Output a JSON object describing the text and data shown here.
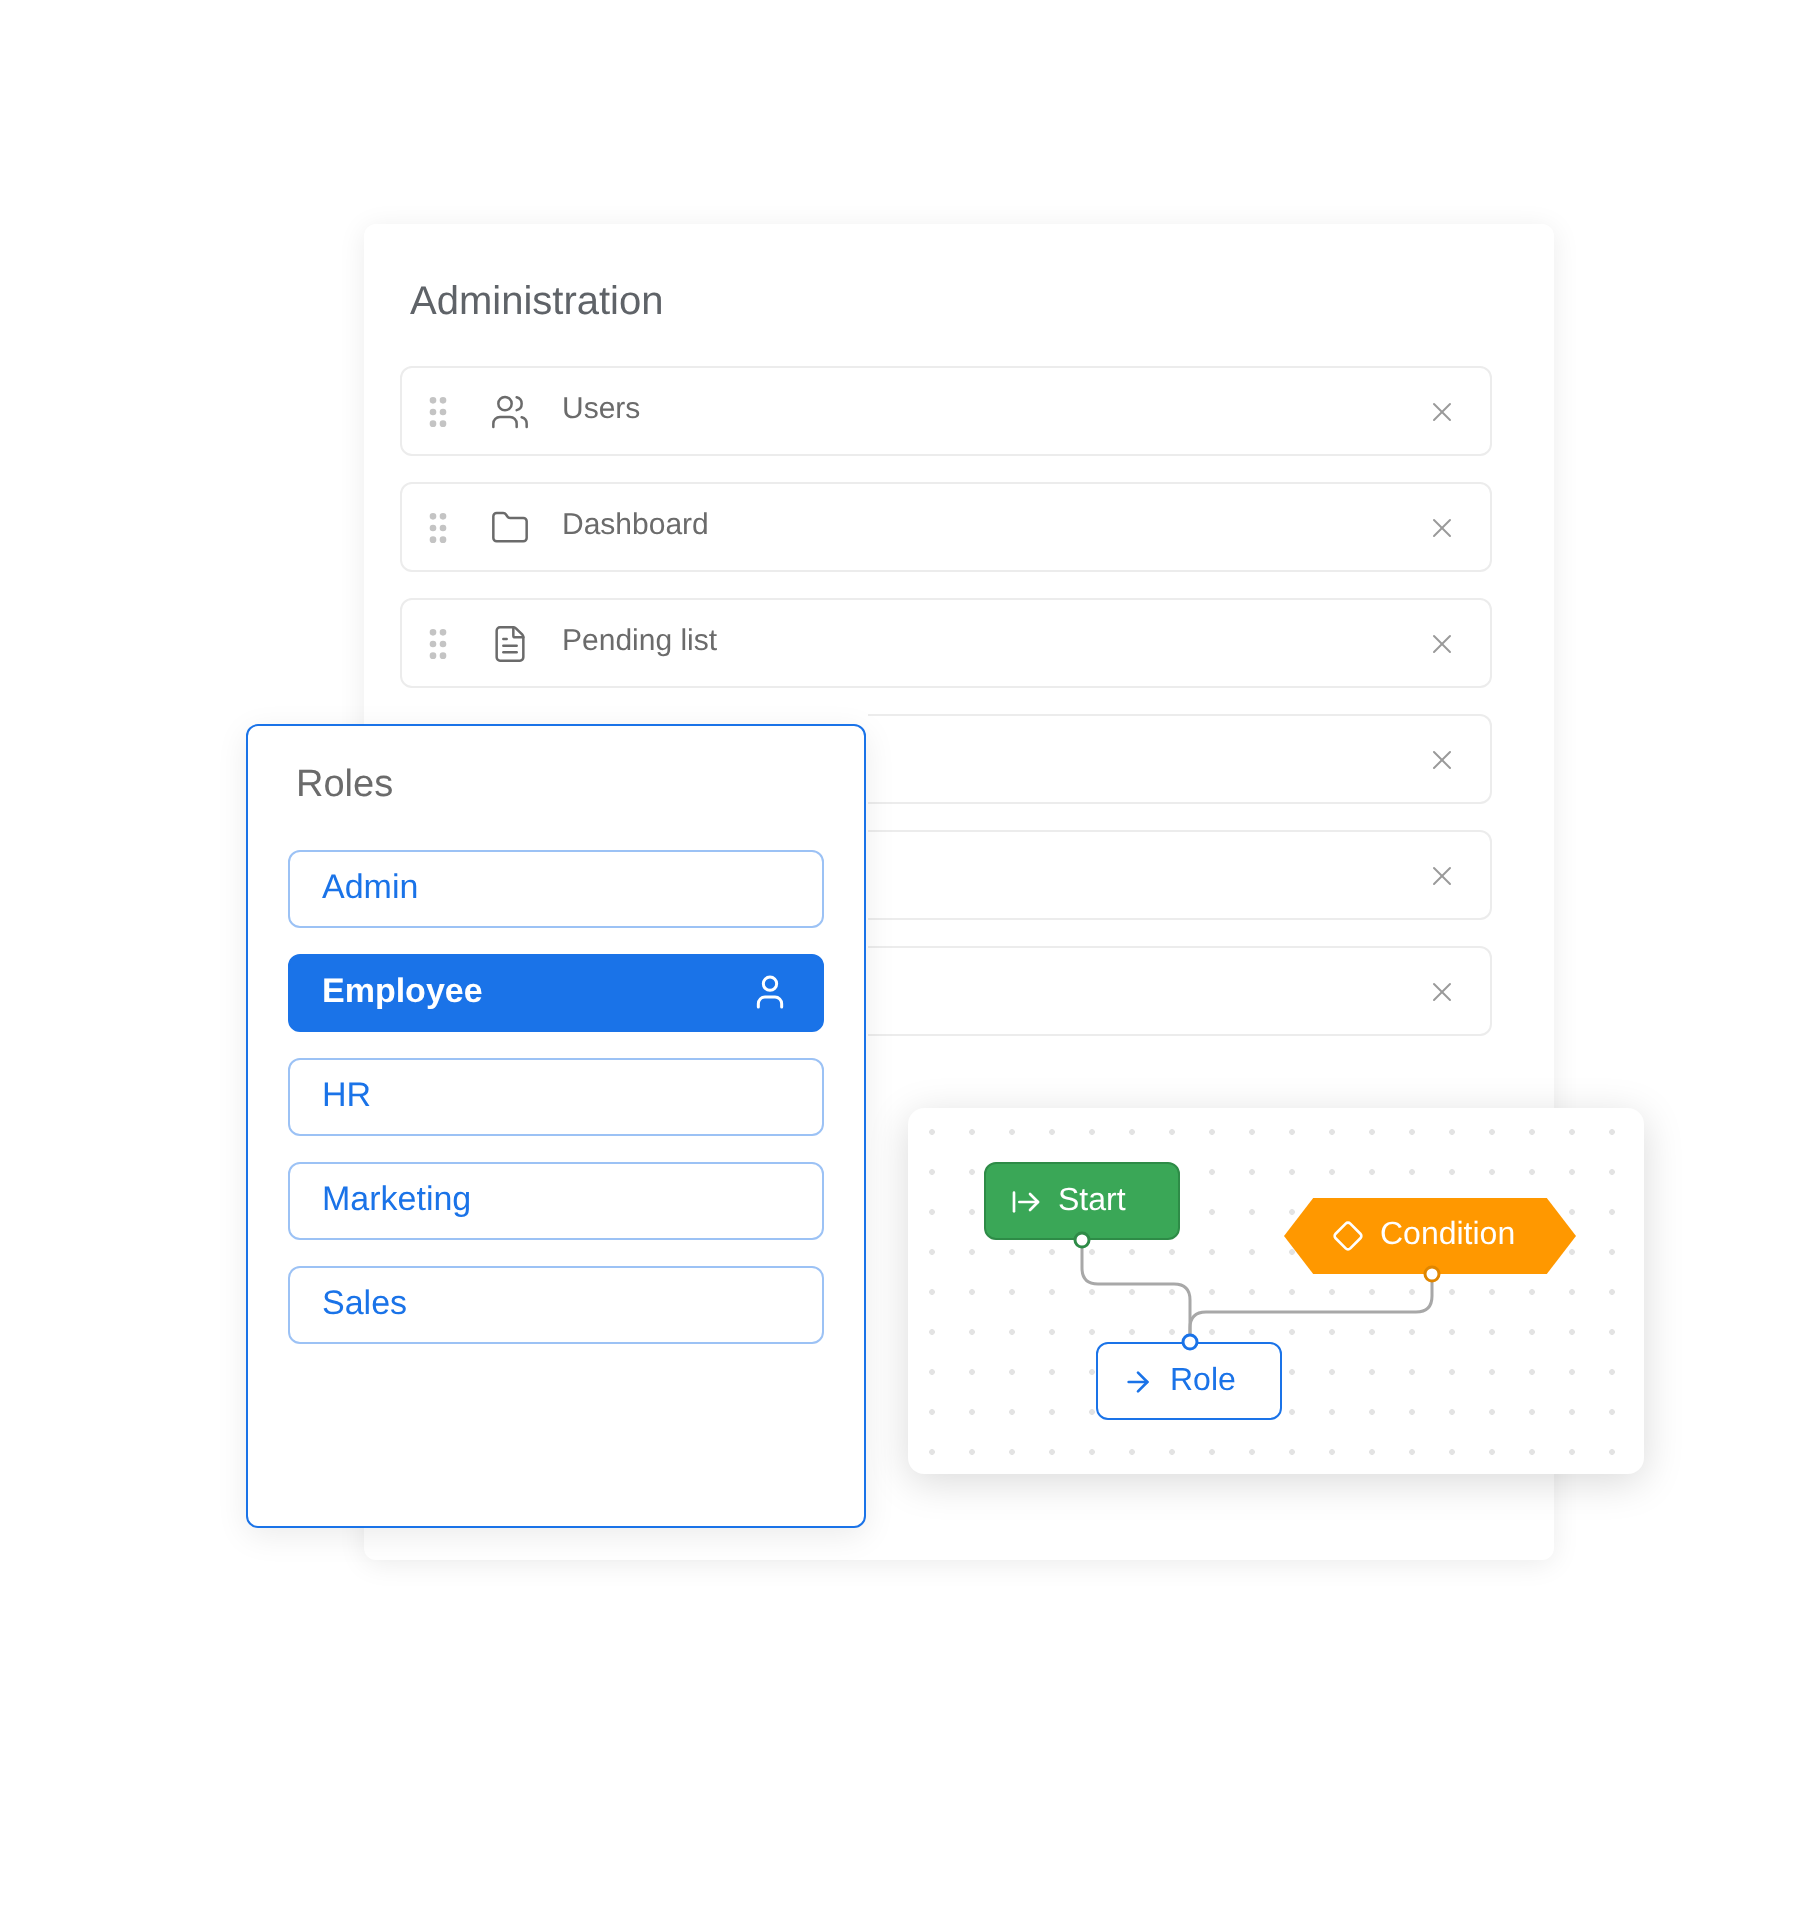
{
  "administration": {
    "title": "Administration",
    "items": [
      {
        "kind": "users",
        "label": "Users"
      },
      {
        "kind": "folder",
        "label": "Dashboard"
      },
      {
        "kind": "list",
        "label": "Pending list"
      },
      {
        "kind": "covered"
      },
      {
        "kind": "covered"
      },
      {
        "kind": "covered"
      }
    ]
  },
  "roles": {
    "title": "Roles",
    "items": [
      {
        "label": "Admin",
        "selected": false
      },
      {
        "label": "Employee",
        "selected": true
      },
      {
        "label": "HR",
        "selected": false
      },
      {
        "label": "Marketing",
        "selected": false
      },
      {
        "label": "Sales",
        "selected": false
      }
    ]
  },
  "flow": {
    "nodes": [
      {
        "kind": "start",
        "label": "Start"
      },
      {
        "kind": "condition",
        "label": "Condition"
      },
      {
        "kind": "role",
        "label": "Role"
      }
    ]
  }
}
